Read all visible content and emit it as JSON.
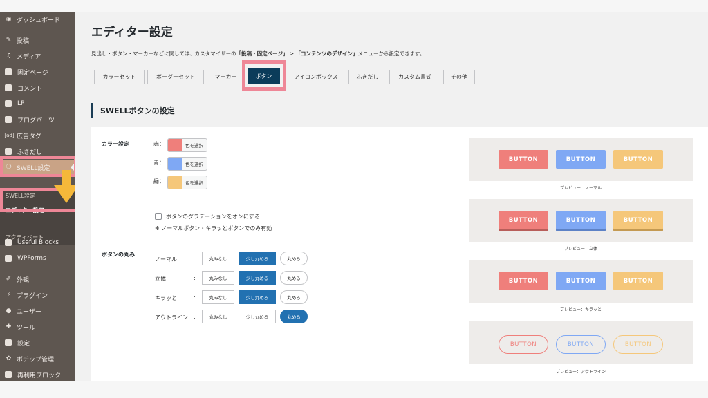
{
  "sidebar": {
    "items": [
      {
        "label": "ダッシュボード",
        "icon": "palette-icon"
      },
      {
        "label": "投稿",
        "icon": "pin-icon"
      },
      {
        "label": "メディア",
        "icon": "media-icon"
      },
      {
        "label": "固定ページ",
        "icon": "page-icon"
      },
      {
        "label": "コメント",
        "icon": "comment-icon"
      },
      {
        "label": "LP",
        "icon": "lp-icon"
      },
      {
        "label": "ブログパーツ",
        "icon": "blog-parts-icon"
      },
      {
        "label": "広告タグ",
        "icon": "ad-icon",
        "glyph": "[ad]"
      },
      {
        "label": "ふきだし",
        "icon": "balloon-icon"
      },
      {
        "label": "SWELL設定",
        "icon": "swell-icon"
      },
      {
        "label": "Useful Blocks",
        "icon": "useful-blocks-icon"
      },
      {
        "label": "WPForms",
        "icon": "wpforms-icon"
      },
      {
        "label": "外観",
        "icon": "brush-icon"
      },
      {
        "label": "プラグイン",
        "icon": "plugin-icon"
      },
      {
        "label": "ユーザー",
        "icon": "user-icon"
      },
      {
        "label": "ツール",
        "icon": "wrench-icon"
      },
      {
        "label": "設定",
        "icon": "settings-icon"
      },
      {
        "label": "ポチップ管理",
        "icon": "paw-icon"
      },
      {
        "label": "再利用ブロック",
        "icon": "reusable-block-icon"
      }
    ],
    "submenu": [
      {
        "label": "SWELL設定"
      },
      {
        "label": "エディター設定"
      },
      {
        "label": "アクティベート"
      }
    ]
  },
  "header": {
    "title": "エディター設定",
    "desc_before": "見出し・ボタン・マーカーなどに関しては、カスタマイザーの",
    "desc_b1": "「投稿・固定ページ」",
    "desc_mid": " > ",
    "desc_b2": "「コンテンツのデザイン」",
    "desc_after": "メニューから設定できます。"
  },
  "tabs": [
    {
      "label": "カラーセット"
    },
    {
      "label": "ボーダーセット"
    },
    {
      "label": "マーカー"
    },
    {
      "label": "ボタン",
      "active": true
    },
    {
      "label": "アイコンボックス"
    },
    {
      "label": "ふきだし"
    },
    {
      "label": "カスタム書式"
    },
    {
      "label": "その他"
    }
  ],
  "section": {
    "title": "SWELLボタンの設定"
  },
  "color_settings": {
    "label": "カラー設定",
    "picker_text": "色を選択",
    "colors": [
      {
        "label": "赤：",
        "value": "#ef7f7b"
      },
      {
        "label": "青：",
        "value": "#7fa8f4"
      },
      {
        "label": "緑：",
        "value": "#f5c77a"
      }
    ],
    "gradient_label": "ボタンのグラデーションをオンにする",
    "note": "※ ノーマルボタン・キラッとボタンでのみ有効"
  },
  "radius_settings": {
    "label": "ボタンの丸み",
    "options": [
      "丸みなし",
      "少し丸める",
      "丸める"
    ],
    "rows": [
      {
        "label": "ノーマル",
        "selected": "少し丸める"
      },
      {
        "label": "立体",
        "selected": "少し丸める"
      },
      {
        "label": "キラッと",
        "selected": "少し丸める"
      },
      {
        "label": "アウトライン",
        "selected": "丸める"
      }
    ]
  },
  "previews": {
    "button_text": "BUTTON",
    "captions": [
      "プレビュー：ノーマル",
      "プレビュー：立体",
      "プレビュー：キラッと",
      "プレビュー：アウトライン"
    ]
  }
}
